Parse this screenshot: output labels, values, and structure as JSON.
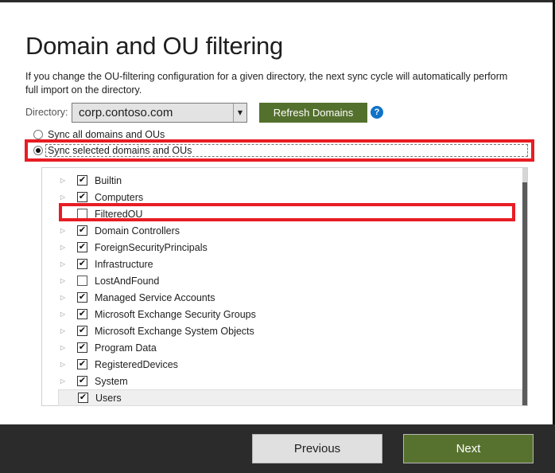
{
  "page": {
    "title": "Domain and OU filtering",
    "description": "If you change the OU-filtering configuration for a given directory, the next sync cycle will automatically perform full import on the directory."
  },
  "directory": {
    "label": "Directory:",
    "selected": "corp.contoso.com",
    "refresh_label": "Refresh Domains",
    "help_glyph": "?"
  },
  "sync_options": [
    {
      "label": "Sync all domains and OUs",
      "checked": false
    },
    {
      "label": "Sync selected domains and OUs",
      "checked": true
    }
  ],
  "ou_tree": [
    {
      "name": "Builtin",
      "checked": true,
      "expandable": true
    },
    {
      "name": "Computers",
      "checked": true,
      "expandable": true
    },
    {
      "name": "FilteredOU",
      "checked": false,
      "expandable": false
    },
    {
      "name": "Domain Controllers",
      "checked": true,
      "expandable": true
    },
    {
      "name": "ForeignSecurityPrincipals",
      "checked": true,
      "expandable": true
    },
    {
      "name": "Infrastructure",
      "checked": true,
      "expandable": true
    },
    {
      "name": "LostAndFound",
      "checked": false,
      "expandable": true
    },
    {
      "name": "Managed Service Accounts",
      "checked": true,
      "expandable": true
    },
    {
      "name": "Microsoft Exchange Security Groups",
      "checked": true,
      "expandable": true
    },
    {
      "name": "Microsoft Exchange System Objects",
      "checked": true,
      "expandable": true
    },
    {
      "name": "Program Data",
      "checked": true,
      "expandable": true
    },
    {
      "name": "RegisteredDevices",
      "checked": true,
      "expandable": true
    },
    {
      "name": "System",
      "checked": true,
      "expandable": true
    },
    {
      "name": "Users",
      "checked": true,
      "expandable": false,
      "selected": true
    }
  ],
  "icons": {
    "expander": "▷",
    "checkmark": "✔",
    "dropdown": "▼"
  },
  "footer": {
    "previous_label": "Previous",
    "next_label": "Next"
  },
  "colors": {
    "accent_green": "#54702d",
    "highlight_red": "#e81c24",
    "help_blue": "#1073c8",
    "footer_bg": "#2b2b2b"
  }
}
